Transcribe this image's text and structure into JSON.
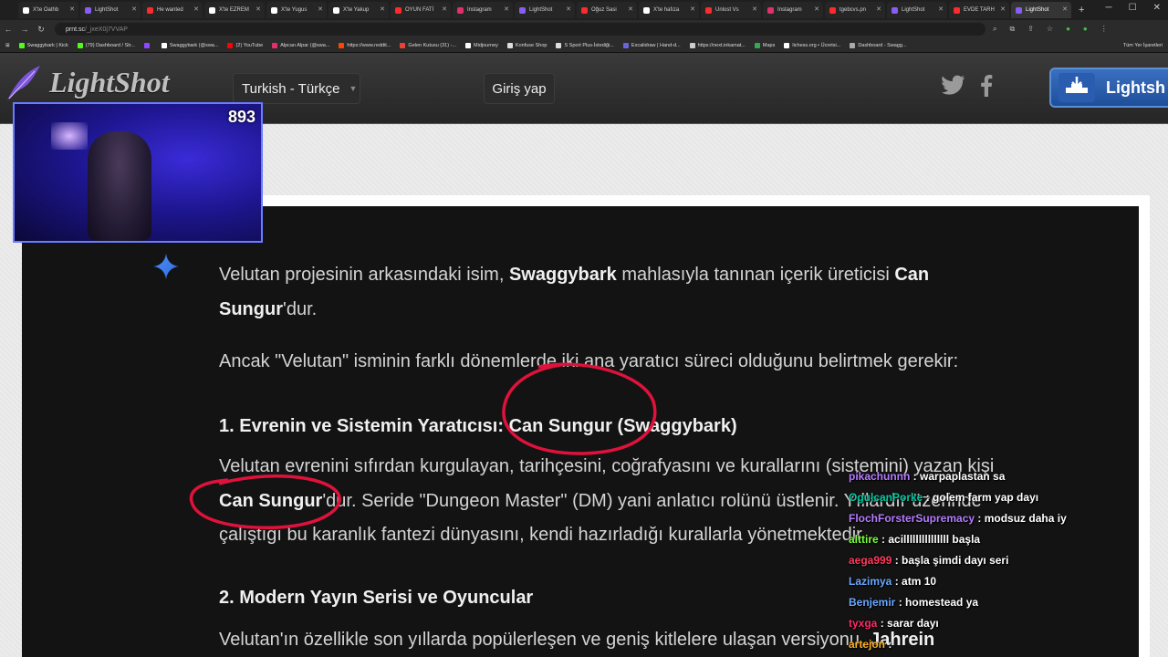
{
  "tabs": [
    {
      "label": "X'te Oathb",
      "color": "#ffffff",
      "active": false
    },
    {
      "label": "LightShot",
      "color": "#8a5cf6",
      "active": false
    },
    {
      "label": "He wanted",
      "color": "#ff2a2a",
      "active": false
    },
    {
      "label": "X'te EZREM",
      "color": "#ffffff",
      "active": false
    },
    {
      "label": "X'te Yugus",
      "color": "#ffffff",
      "active": false
    },
    {
      "label": "X'te Yakup",
      "color": "#ffffff",
      "active": false
    },
    {
      "label": "OYUN FATİ",
      "color": "#ff2a2a",
      "active": false
    },
    {
      "label": "Instagram",
      "color": "#e1306c",
      "active": false
    },
    {
      "label": "LightShot",
      "color": "#8a5cf6",
      "active": false
    },
    {
      "label": "Oğuz Sasi",
      "color": "#ff2a2a",
      "active": false
    },
    {
      "label": "X'te hafıza",
      "color": "#ffffff",
      "active": false
    },
    {
      "label": "Unlost Vs",
      "color": "#ff2a2a",
      "active": false
    },
    {
      "label": "Instagram",
      "color": "#e1306c",
      "active": false
    },
    {
      "label": "tgebcvs.pn",
      "color": "#ff2a2a",
      "active": false
    },
    {
      "label": "LightShot",
      "color": "#8a5cf6",
      "active": false
    },
    {
      "label": "EVDE TARH",
      "color": "#ff2a2a",
      "active": false
    },
    {
      "label": "LightShot",
      "color": "#8a5cf6",
      "active": true
    }
  ],
  "address": {
    "host": "prnt.sc",
    "path": "/_jxeX0j7VVAP"
  },
  "bookmarks": [
    {
      "label": "Swaggybark | Kick",
      "color": "#53fc18"
    },
    {
      "label": "(79) Dashboard / Str...",
      "color": "#53fc18"
    },
    {
      "label": "",
      "color": "#9146ff"
    },
    {
      "label": "Swaggybark (@swa...",
      "color": "#ffffff"
    },
    {
      "label": "(2) YouTube",
      "color": "#ff0000"
    },
    {
      "label": "Alpcan Alpar (@swa...",
      "color": "#e1306c"
    },
    {
      "label": "https://www.reddit...",
      "color": "#ff4500"
    },
    {
      "label": "Gelen Kutusu (31) -...",
      "color": "#ea4335"
    },
    {
      "label": "Midjourney",
      "color": "#ffffff"
    },
    {
      "label": "Konfuse Shop",
      "color": "#dddddd"
    },
    {
      "label": "S Sport Plus-İstediği...",
      "color": "#dddddd"
    },
    {
      "label": "Excalidraw | Hand-d...",
      "color": "#6965db"
    },
    {
      "label": "https://next.inkamat...",
      "color": "#cccccc"
    },
    {
      "label": "Maps",
      "color": "#34a853"
    },
    {
      "label": "lichess.org • Ücretsi...",
      "color": "#ffffff"
    },
    {
      "label": "Dashboard - Swagg...",
      "color": "#aaaaaa"
    }
  ],
  "bookmarks_right": "Tüm Yer İşaretleri",
  "header": {
    "brand": "LightShot",
    "language": "Turkish - Türkçe",
    "login": "Giriş yap",
    "download": "Lightsh"
  },
  "webcam": {
    "viewer_count": "893"
  },
  "article": {
    "p1_a": "Velutan projesinin arkasındaki isim, ",
    "p1_b": "Swaggybark",
    "p1_c": " mahlasıyla tanınan içerik üreticisi ",
    "p1_d": "Can",
    "p1_e": "Sungur",
    "p1_f": "'dur.",
    "p2": "Ancak \"Velutan\" isminin farklı dönemlerde iki ana yaratıcı süreci olduğunu belirtmek gerekir:",
    "h1": "1. Evrenin ve Sistemin Yaratıcısı: Can Sungur (Swaggybark)",
    "p3": "Velutan evrenini sıfırdan kurgulayan, tarihçesini, coğrafyasını ve kurallarını (sistemini) yazan kişi",
    "p4_a": "Can Sungur",
    "p4_b": "'dur. Seride \"Dungeon Master\" (DM) yani anlatıcı rolünü üstlenir. Yıllardır üzerinde",
    "p5": "çalıştığı bu karanlık fantezi dünyasını, kendi hazırladığı kurallarla yönetmektedir.",
    "h2": "2. Modern Yayın Serisi ve Oyuncular",
    "p6_a": "Velutan'ın özellikle son yıllarda popülerleşen ve geniş kitlelere ulaşan versiyonu, ",
    "p6_b": "Jahrein"
  },
  "chat": [
    {
      "user": "pikachunnn",
      "msg": "warpaplastan sa",
      "color": "#b57bff"
    },
    {
      "user": "OgulcanPorke",
      "msg": "golem farm yap dayı",
      "color": "#00c8a0"
    },
    {
      "user": "FlochForsterSupremacy",
      "msg": "modsuz daha iy",
      "color": "#b57bff"
    },
    {
      "user": "alttire",
      "msg": "acilllllllllllllll başla",
      "color": "#7cff3a"
    },
    {
      "user": "aega999",
      "msg": "başla şimdi dayı seri",
      "color": "#ff3a5c"
    },
    {
      "user": "Lazimya",
      "msg": "atm 10",
      "color": "#6aa8ff"
    },
    {
      "user": "Benjemir",
      "msg": "homestead ya",
      "color": "#6aa8ff"
    },
    {
      "user": "tyxga",
      "msg": "sarar dayı",
      "color": "#ff2a6a"
    },
    {
      "user": "artejon",
      "msg": "",
      "color": "#ffb020"
    }
  ]
}
